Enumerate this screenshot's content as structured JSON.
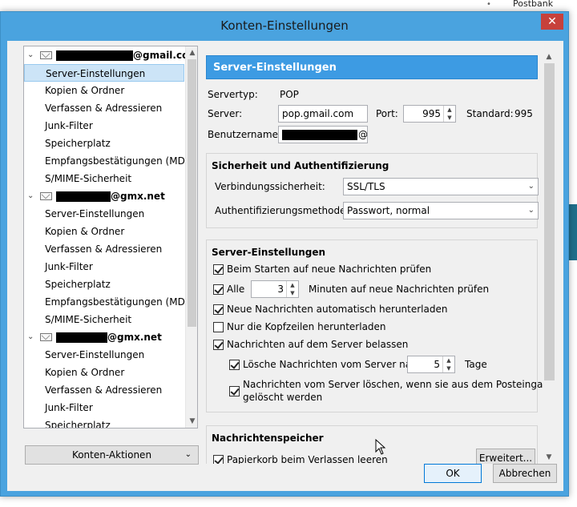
{
  "background": {
    "postbank": "Postbank",
    "dot": "•"
  },
  "window": {
    "title": "Konten-Einstellungen",
    "close_symbol": "✕"
  },
  "tree": {
    "accounts": [
      {
        "domain": "@gmail.com",
        "items": [
          "Server-Einstellungen",
          "Kopien & Ordner",
          "Verfassen & Adressieren",
          "Junk-Filter",
          "Speicherplatz",
          "Empfangsbestätigungen (MDN)",
          "S/MIME-Sicherheit"
        ]
      },
      {
        "domain": "@gmx.net",
        "items": [
          "Server-Einstellungen",
          "Kopien & Ordner",
          "Verfassen & Adressieren",
          "Junk-Filter",
          "Speicherplatz",
          "Empfangsbestätigungen (MDN)",
          "S/MIME-Sicherheit"
        ]
      },
      {
        "domain": "@gmx.net",
        "items": [
          "Server-Einstellungen",
          "Kopien & Ordner",
          "Verfassen & Adressieren",
          "Junk-Filter",
          "Speicherplatz"
        ]
      }
    ],
    "selected_index": 0,
    "chevron": "⌄",
    "scroll_up": "▲",
    "scroll_down": "▼"
  },
  "konten_aktionen": {
    "label": "Konten-Aktionen",
    "chevron": "⌄"
  },
  "panel": {
    "header": "Server-Einstellungen",
    "servertyp_label": "Servertyp:",
    "servertyp_value": "POP",
    "server_label": "Server:",
    "server_value": "pop.gmail.com",
    "port_label": "Port:",
    "port_value": "995",
    "standard_label": "Standard:",
    "standard_value": "995",
    "benutzername_label": "Benutzername:",
    "benutzername_suffix": "@",
    "security": {
      "title": "Sicherheit und Authentifizierung",
      "verbindung_label": "Verbindungssicherheit:",
      "verbindung_value": "SSL/TLS",
      "auth_label": "Authentifizierungsmethode:",
      "auth_value": "Passwort, normal"
    },
    "server_settings": {
      "title": "Server-Einstellungen",
      "check_on_start": "Beim Starten auf neue Nachrichten prüfen",
      "alle_label": "Alle",
      "alle_value": "3",
      "minutes_label": "Minuten auf neue Nachrichten prüfen",
      "auto_download": "Neue Nachrichten automatisch herunterladen",
      "headers_only": "Nur die Kopfzeilen herunterladen",
      "leave_on_server": "Nachrichten auf dem Server belassen",
      "delete_after_label": "Lösche Nachrichten vom Server nach",
      "delete_after_value": "5",
      "tage_label": "Tage",
      "delete_when_removed": "Nachrichten vom Server löschen, wenn sie aus dem Posteingang",
      "delete_when_removed_2": "gelöscht werden"
    },
    "storage": {
      "title": "Nachrichtenspeicher",
      "empty_trash": "Papierkorb beim Verlassen leeren",
      "erweitert": "Erweitert..."
    }
  },
  "buttons": {
    "ok": "OK",
    "cancel": "Abbrechen"
  }
}
